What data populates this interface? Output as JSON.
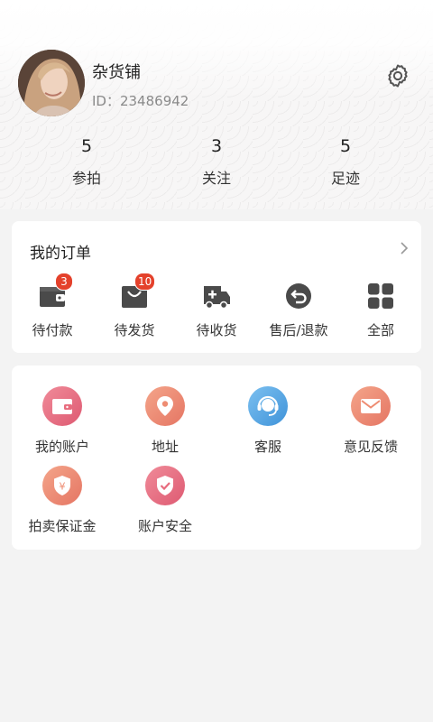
{
  "profile": {
    "name": "杂货铺",
    "id_text": "ID：23486942"
  },
  "stats": [
    {
      "value": "5",
      "label": "参拍"
    },
    {
      "value": "3",
      "label": "关注"
    },
    {
      "value": "5",
      "label": "足迹"
    }
  ],
  "orders": {
    "title": "我的订单",
    "items": [
      {
        "label": "待付款",
        "badge": "3",
        "icon": "wallet-icon"
      },
      {
        "label": "待发货",
        "badge": "10",
        "icon": "shopping-bag-icon"
      },
      {
        "label": "待收货",
        "icon": "truck-icon"
      },
      {
        "label": "售后/退款",
        "icon": "return-icon"
      },
      {
        "label": "全部",
        "icon": "grid-icon"
      }
    ]
  },
  "services": {
    "items": [
      {
        "label": "我的账户",
        "icon": "wallet-icon",
        "color": "#e86c7e"
      },
      {
        "label": "地址",
        "icon": "location-pin-icon",
        "color": "#ee8c72"
      },
      {
        "label": "客服",
        "icon": "headset-icon",
        "color": "#58a9e6"
      },
      {
        "label": "意见反馈",
        "icon": "mail-icon",
        "color": "#ee8c72"
      },
      {
        "label": "拍卖保证金",
        "icon": "yen-shield-icon",
        "color": "#ee8c72"
      },
      {
        "label": "账户安全",
        "icon": "shield-check-icon",
        "color": "#e86c7e"
      }
    ]
  },
  "colors": {
    "badge": "#e4412b",
    "icon_dark": "#4a4a4a"
  }
}
